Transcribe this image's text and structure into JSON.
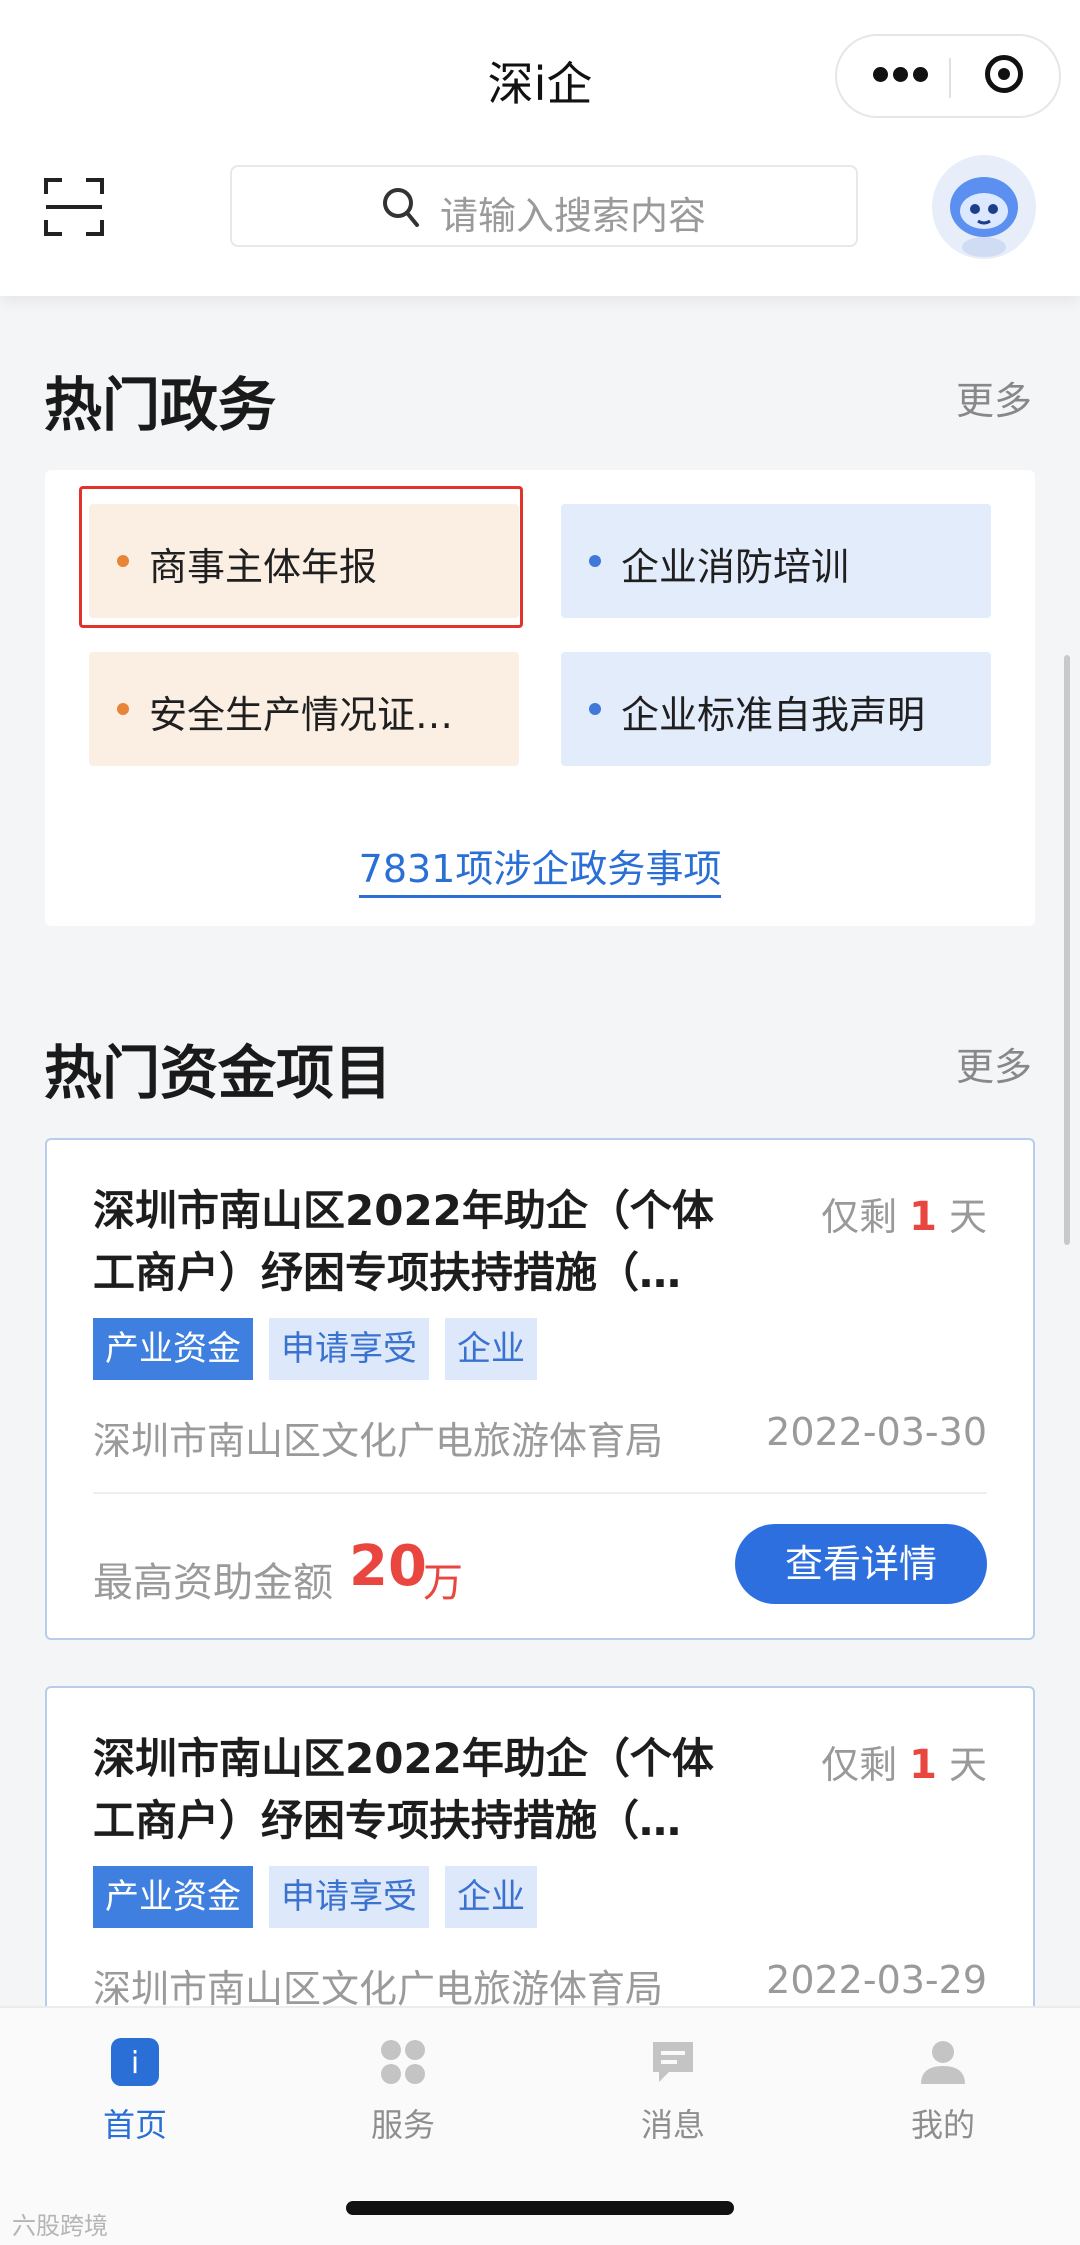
{
  "app": {
    "title": "深i企"
  },
  "search": {
    "placeholder": "请输入搜索内容"
  },
  "hot_gov": {
    "title": "热门政务",
    "more": "更多",
    "tiles": [
      {
        "label": "商事主体年报",
        "color": "orange"
      },
      {
        "label": "企业消防培训",
        "color": "blue"
      },
      {
        "label": "安全生产情况证…",
        "color": "orange"
      },
      {
        "label": "企业标准自我声明",
        "color": "blue"
      }
    ],
    "count_link": "7831项涉企政务事项"
  },
  "hot_funds": {
    "title": "热门资金项目",
    "more": "更多",
    "cards": [
      {
        "title": "深圳市南山区2022年助企（个体工商户）纾困专项扶持措施（…",
        "remain_prefix": "仅剩",
        "remain_days": "1",
        "remain_suffix": "天",
        "tags": [
          "产业资金",
          "申请享受",
          "企业"
        ],
        "dept": "深圳市南山区文化广电旅游体育局",
        "date": "2022-03-30",
        "amount_label": "最高资助金额",
        "amount": "20",
        "amount_unit": "万",
        "button": "查看详情"
      },
      {
        "title": "深圳市南山区2022年助企（个体工商户）纾困专项扶持措施（…",
        "remain_prefix": "仅剩",
        "remain_days": "1",
        "remain_suffix": "天",
        "tags": [
          "产业资金",
          "申请享受",
          "企业"
        ],
        "dept": "深圳市南山区文化广电旅游体育局",
        "date": "2022-03-29"
      }
    ]
  },
  "tabbar": {
    "items": [
      {
        "label": "首页",
        "icon": "home-icon",
        "active": true
      },
      {
        "label": "服务",
        "icon": "service-grid-icon",
        "active": false
      },
      {
        "label": "消息",
        "icon": "message-icon",
        "active": false
      },
      {
        "label": "我的",
        "icon": "profile-icon",
        "active": false
      }
    ]
  },
  "watermark": "六股跨境",
  "colors": {
    "accent": "#2e6fe0",
    "highlight": "#e2332b",
    "alert": "#e9463f"
  }
}
